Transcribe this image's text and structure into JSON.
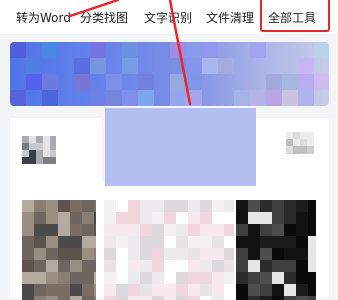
{
  "tabs": [
    {
      "label": "转为Word",
      "selected": false
    },
    {
      "label": "分类找图",
      "selected": false
    },
    {
      "label": "文字识别",
      "selected": false
    },
    {
      "label": "文件清理",
      "selected": false
    },
    {
      "label": "全部工具",
      "selected": true
    }
  ],
  "colors": {
    "annotation_red": "#e8262b",
    "banner_blue": "#4f74e8",
    "placeholder": "#b2bff0"
  }
}
